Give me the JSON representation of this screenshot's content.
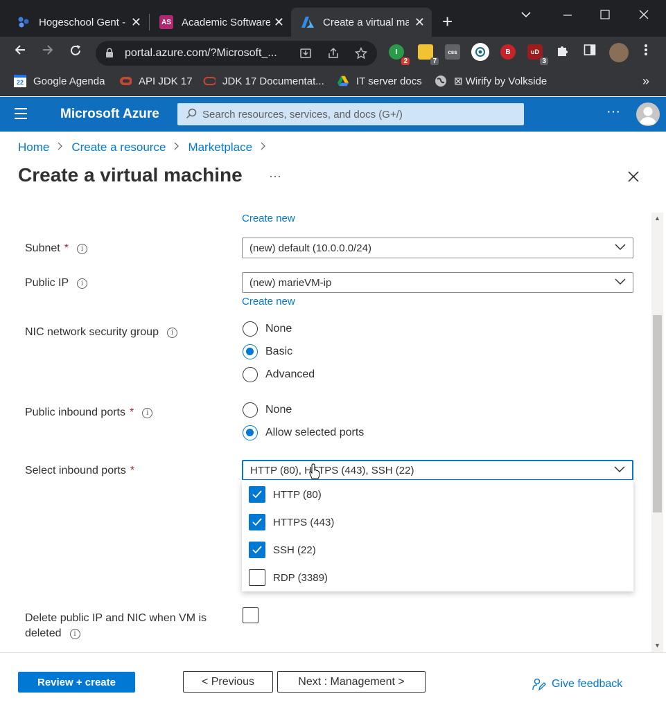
{
  "browser": {
    "tabs": [
      {
        "title": "Hogeschool Gent -",
        "icon": "hogent-icon"
      },
      {
        "title": "Academic Software",
        "icon": "academic-software-icon",
        "icon_text": "AS"
      },
      {
        "title": "Create a virtual ma",
        "icon": "azure-icon"
      }
    ],
    "url": "portal.azure.com/?Microsoft_...",
    "extension_badges": {
      "ext1": "2",
      "ext2": "7",
      "ext3": "3"
    },
    "bookmarks": [
      {
        "label": "Google Agenda",
        "icon": "calendar-icon",
        "icon_text": "22"
      },
      {
        "label": "API JDK 17",
        "icon": "oracle-icon"
      },
      {
        "label": "JDK 17 Documentat...",
        "icon": "oracle-ring-icon"
      },
      {
        "label": "IT server docs",
        "icon": "drive-icon"
      },
      {
        "label": "⊠ Wirify by Volkside",
        "icon": "globe-icon"
      }
    ],
    "bookmarks_more": "»"
  },
  "azure": {
    "brand": "Microsoft Azure",
    "search_placeholder": "Search resources, services, and docs (G+/)",
    "more": "···"
  },
  "breadcrumb": [
    "Home",
    "Create a resource",
    "Marketplace"
  ],
  "page": {
    "title": "Create a virtual machine",
    "more": "···"
  },
  "form": {
    "vnet_create_new": "Create new",
    "subnet": {
      "label": "Subnet",
      "value": "(new) default (10.0.0.0/24)"
    },
    "public_ip": {
      "label": "Public IP",
      "value": "(new) marieVM-ip",
      "create_new": "Create new"
    },
    "nic_nsg": {
      "label": "NIC network security group",
      "options": [
        "None",
        "Basic",
        "Advanced"
      ],
      "selected": "Basic"
    },
    "public_inbound": {
      "label": "Public inbound ports",
      "options": [
        "None",
        "Allow selected ports"
      ],
      "selected": "Allow selected ports"
    },
    "select_inbound": {
      "label": "Select inbound ports",
      "value": "HTTP (80), HTTPS (443), SSH (22)",
      "options": [
        {
          "label": "HTTP (80)",
          "checked": true
        },
        {
          "label": "HTTPS (443)",
          "checked": true
        },
        {
          "label": "SSH (22)",
          "checked": true
        },
        {
          "label": "RDP (3389)",
          "checked": false
        }
      ]
    },
    "delete_ip": {
      "label_line1": "Delete public IP and NIC when VM is",
      "label_line2": "deleted",
      "checked": false
    },
    "required_mark": "*",
    "info_mark": "i"
  },
  "footer": {
    "review_create": "Review + create",
    "previous": "< Previous",
    "next": "Next : Management >",
    "feedback": "Give feedback"
  },
  "colors": {
    "azure_blue": "#0078d4",
    "header_blue": "#106ebe",
    "required_red": "#a4262c"
  }
}
